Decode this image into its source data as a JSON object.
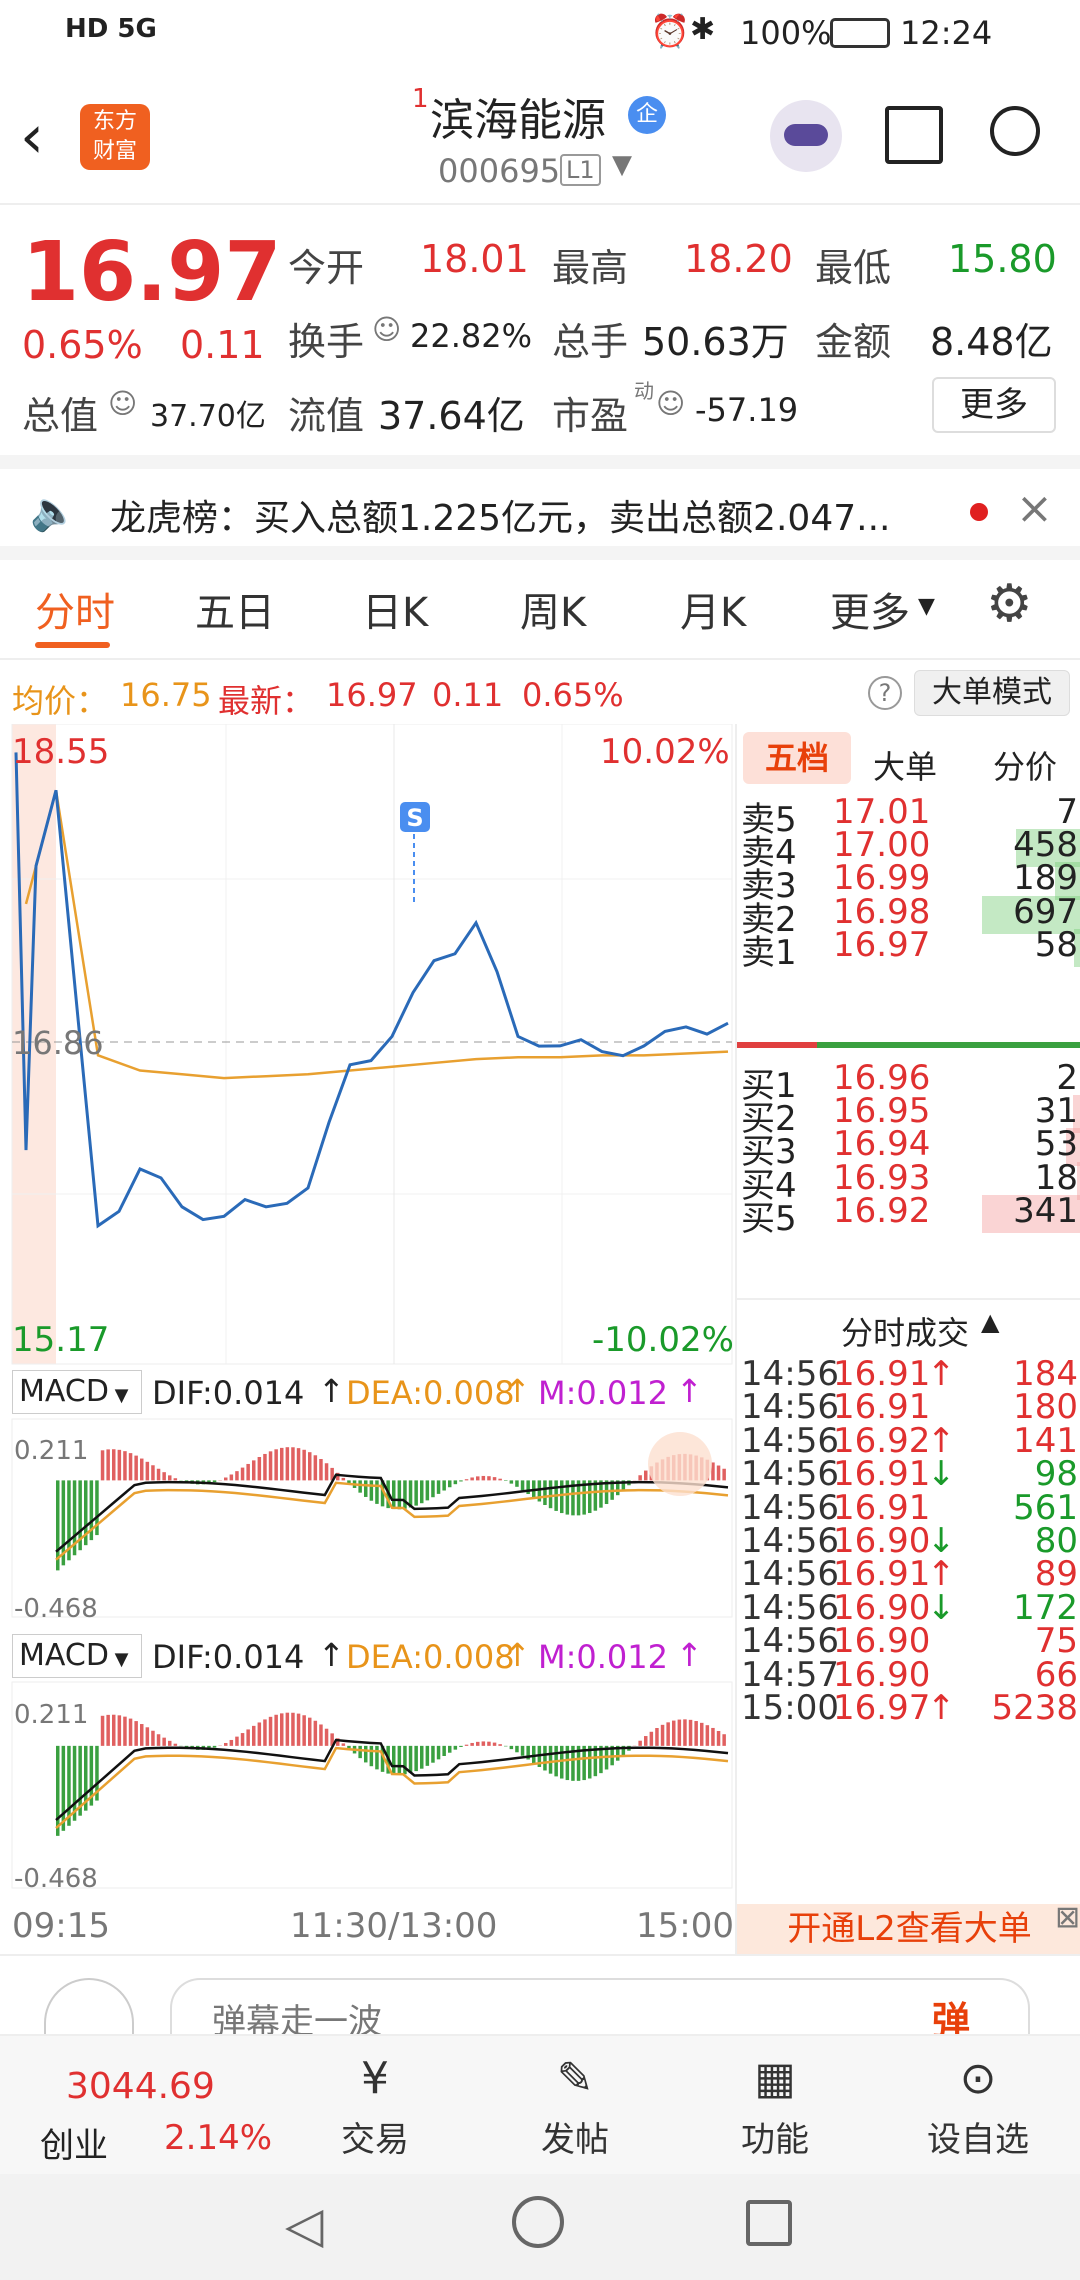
{
  "status_bar": {
    "left": "HD 5G",
    "battery": "100%",
    "time": "12:24"
  },
  "header": {
    "title": "滨海能源",
    "superscript": "1",
    "badge": "企",
    "code": "000695",
    "level": "L1",
    "logo_line1": "东方",
    "logo_line2": "财富"
  },
  "quote": {
    "price": "16.97",
    "change_pct": "0.65%",
    "change": "0.11",
    "open_label": "今开",
    "open": "18.01",
    "high_label": "最高",
    "high": "18.20",
    "low_label": "最低",
    "low": "15.80",
    "turnover_label": "换手",
    "turnover": "22.82%",
    "volume_label": "总手",
    "volume": "50.63万",
    "amount_label": "金额",
    "amount": "8.48亿",
    "total_value_label": "总值",
    "total_value": "37.70亿",
    "float_value_label": "流值",
    "float_value": "37.64亿",
    "pe_label": "市盈",
    "pe_sup": "动",
    "pe": "-57.19",
    "more": "更多"
  },
  "notice": {
    "text": "龙虎榜：买入总额1.225亿元，卖出总额2.047..."
  },
  "tabs": [
    "分时",
    "五日",
    "日K",
    "周K",
    "月K",
    "更多"
  ],
  "avg_line": {
    "avg_label": "均价：",
    "avg": "16.75",
    "latest_label": "最新：",
    "latest": "16.97",
    "chg": "0.11",
    "pct": "0.65%",
    "mode": "大单模式"
  },
  "chart_labels": {
    "top_left": "18.55",
    "top_right": "10.02%",
    "bottom_left": "15.17",
    "bottom_right": "-10.02%",
    "mid": "16.86",
    "s_marker": "S",
    "x_start": "09:15",
    "x_mid": "11:30/13:00",
    "x_end": "15:00"
  },
  "chart_data": {
    "type": "line",
    "x": [
      "09:30",
      "09:45",
      "10:00",
      "10:15",
      "10:30",
      "10:45",
      "11:00",
      "11:15",
      "11:30",
      "13:15",
      "13:30",
      "13:45",
      "14:00",
      "14:15",
      "14:30",
      "14:45",
      "15:00"
    ],
    "series": [
      {
        "values": [
          18.2,
          15.9,
          16.2,
          16.0,
          15.95,
          16.0,
          16.1,
          16.75,
          16.9,
          17.3,
          17.5,
          16.9,
          16.85,
          16.82,
          16.85,
          16.95,
          16.97
        ]
      },
      {
        "values": [
          18.2,
          16.8,
          16.72,
          16.7,
          16.68,
          16.69,
          16.7,
          16.72,
          16.74,
          16.76,
          16.78,
          16.79,
          16.79,
          16.8,
          16.8,
          16.81,
          16.82
        ]
      }
    ],
    "ylim": [
      15.17,
      18.55
    ]
  },
  "macd1": {
    "name": "MACD",
    "dif": "DIF:0.014",
    "dea": "DEA:0.008",
    "m": "M:0.012",
    "top": "0.211",
    "bottom": "-0.468"
  },
  "macd2": {
    "name": "MACD",
    "dif": "DIF:0.014",
    "dea": "DEA:0.008",
    "m": "M:0.012",
    "top": "0.211",
    "bottom": "-0.468"
  },
  "book_tabs": [
    "五档",
    "大单",
    "分价"
  ],
  "asks": [
    {
      "label": "卖5",
      "price": "17.01",
      "vol": "7"
    },
    {
      "label": "卖4",
      "price": "17.00",
      "vol": "458"
    },
    {
      "label": "卖3",
      "price": "16.99",
      "vol": "189"
    },
    {
      "label": "卖2",
      "price": "16.98",
      "vol": "697"
    },
    {
      "label": "卖1",
      "price": "16.97",
      "vol": "58"
    }
  ],
  "bids": [
    {
      "label": "买1",
      "price": "16.96",
      "vol": "2"
    },
    {
      "label": "买2",
      "price": "16.95",
      "vol": "31"
    },
    {
      "label": "买3",
      "price": "16.94",
      "vol": "53"
    },
    {
      "label": "买4",
      "price": "16.93",
      "vol": "18"
    },
    {
      "label": "买5",
      "price": "16.92",
      "vol": "341"
    }
  ],
  "trades_title": "分时成交",
  "trades": [
    {
      "t": "14:56",
      "p": "16.91",
      "d": "↑",
      "v": "184",
      "c": "red"
    },
    {
      "t": "14:56",
      "p": "16.91",
      "d": "",
      "v": "180",
      "c": "red"
    },
    {
      "t": "14:56",
      "p": "16.92",
      "d": "↑",
      "v": "141",
      "c": "red"
    },
    {
      "t": "14:56",
      "p": "16.91",
      "d": "↓",
      "v": "98",
      "c": "green"
    },
    {
      "t": "14:56",
      "p": "16.91",
      "d": "",
      "v": "561",
      "c": "green"
    },
    {
      "t": "14:56",
      "p": "16.90",
      "d": "↓",
      "v": "80",
      "c": "green"
    },
    {
      "t": "14:56",
      "p": "16.91",
      "d": "↑",
      "v": "89",
      "c": "red"
    },
    {
      "t": "14:56",
      "p": "16.90",
      "d": "↓",
      "v": "172",
      "c": "green"
    },
    {
      "t": "14:56",
      "p": "16.90",
      "d": "",
      "v": "75",
      "c": "red"
    },
    {
      "t": "14:57",
      "p": "16.90",
      "d": "",
      "v": "66",
      "c": "red"
    },
    {
      "t": "15:00",
      "p": "16.97",
      "d": "↑",
      "v": "5238",
      "c": "red"
    }
  ],
  "l2_banner": "开通L2查看大单",
  "comment": {
    "placeholder": "弹幕走一波",
    "btn": "弹"
  },
  "bottom_nav": {
    "index_value": "3044.69",
    "index_name": "创业",
    "index_pct": "2.14%",
    "items": [
      "交易",
      "发帖",
      "功能",
      "设自选"
    ]
  }
}
